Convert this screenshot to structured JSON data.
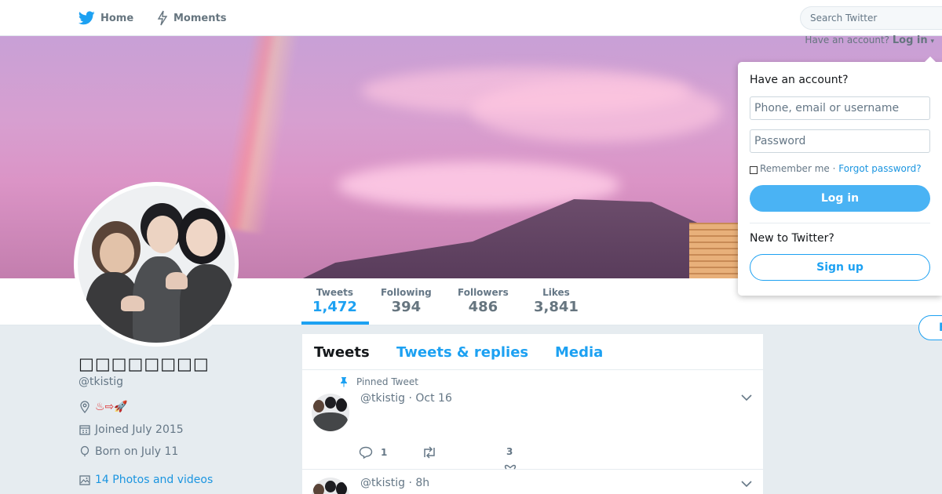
{
  "nav": {
    "home_label": "Home",
    "moments_label": "Moments",
    "search_placeholder": "Search Twitter"
  },
  "header": {
    "have_account": "Have an account?",
    "login_link": "Log in"
  },
  "login_dropdown": {
    "title": "Have an account?",
    "username_placeholder": "Phone, email or username",
    "password_placeholder": "Password",
    "remember_me": "Remember me",
    "separator": " · ",
    "forgot_password": "Forgot password?",
    "login_button": "Log in",
    "new_to_twitter": "New to Twitter?",
    "signup_button": "Sign up"
  },
  "stats": [
    {
      "label": "Tweets",
      "value": "1,472"
    },
    {
      "label": "Following",
      "value": "394"
    },
    {
      "label": "Followers",
      "value": "486"
    },
    {
      "label": "Likes",
      "value": "3,841"
    }
  ],
  "follow_stub_label": "F",
  "profile": {
    "name": "□□□□□□□□",
    "handle": "@tkistig",
    "location": "♨⇨🚀",
    "joined": "Joined July 2015",
    "born": "Born on July 11",
    "photos_videos": "14 Photos and videos"
  },
  "timeline": {
    "tabs": [
      "Tweets",
      "Tweets & replies",
      "Media"
    ],
    "tweets": [
      {
        "pinned_label": "Pinned Tweet",
        "header": "@tkistig · Oct 16",
        "reply_count": "1",
        "retweet_count": "",
        "like_count": "3"
      },
      {
        "header": "@tkistig · 8h"
      }
    ]
  },
  "colors": {
    "accent": "#1da1f2",
    "login_button": "#4ab3f4",
    "background": "#e6ecf0"
  }
}
